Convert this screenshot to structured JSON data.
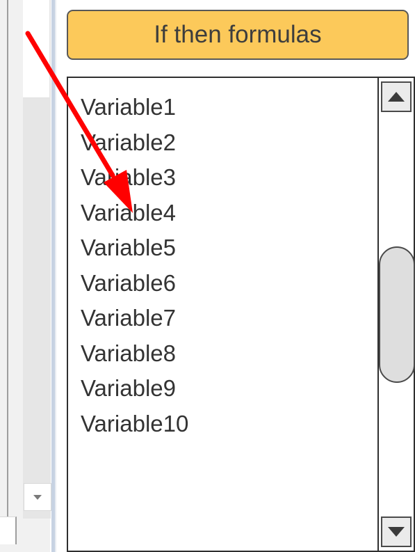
{
  "formula_button": {
    "label": "If then formulas"
  },
  "variables_list": {
    "items": [
      "Variable1",
      "Variable2",
      "Variable3",
      "Variable4",
      "Variable5",
      "Variable6",
      "Variable7",
      "Variable8",
      "Variable9",
      "Variable10"
    ],
    "scroll_position": 0.5
  },
  "annotation": {
    "arrow_color": "#ff0000"
  },
  "icons": {
    "scroll_up": "scroll-up-arrow-icon",
    "scroll_down": "scroll-down-arrow-icon",
    "dropdown": "chevron-down-icon"
  }
}
